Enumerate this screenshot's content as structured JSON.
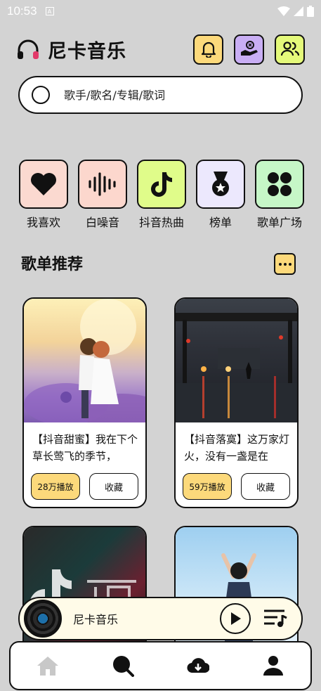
{
  "status": {
    "time": "10:53",
    "a_icon": "A"
  },
  "header": {
    "title": "尼卡音乐",
    "logo_icon": "headphones-icon"
  },
  "search": {
    "placeholder": "歌手/歌名/专辑/歌词"
  },
  "categories": [
    {
      "label": "我喜欢",
      "icon": "heart-icon",
      "color": "#fbd9d0"
    },
    {
      "label": "白噪音",
      "icon": "sound-wave-icon",
      "color": "#fcd7cd"
    },
    {
      "label": "抖音热曲",
      "icon": "tiktok-icon",
      "color": "#e0fc8a"
    },
    {
      "label": "榜单",
      "icon": "medal-icon",
      "color": "#ece8fd"
    },
    {
      "label": "歌单广场",
      "icon": "grid-icon",
      "color": "#c6f7c7"
    }
  ],
  "section": {
    "title": "歌单推荐"
  },
  "cards": [
    {
      "desc": "【抖音甜蜜】我在下个草长莺飞的季节，",
      "plays": "28万播放",
      "collect": "收藏"
    },
    {
      "desc": "【抖音落寞】这万家灯火，没有一盏是在",
      "plays": "59万播放",
      "collect": "收藏"
    },
    {
      "desc": "",
      "plays": "",
      "collect": ""
    },
    {
      "desc": "",
      "plays": "",
      "collect": ""
    }
  ],
  "player": {
    "title": "尼卡音乐"
  },
  "colors": {
    "accent_yellow": "#fcd97b",
    "bell_bg": "#fcd97b",
    "gift_bg": "#c9aef4",
    "people_bg": "#e4f97a"
  }
}
